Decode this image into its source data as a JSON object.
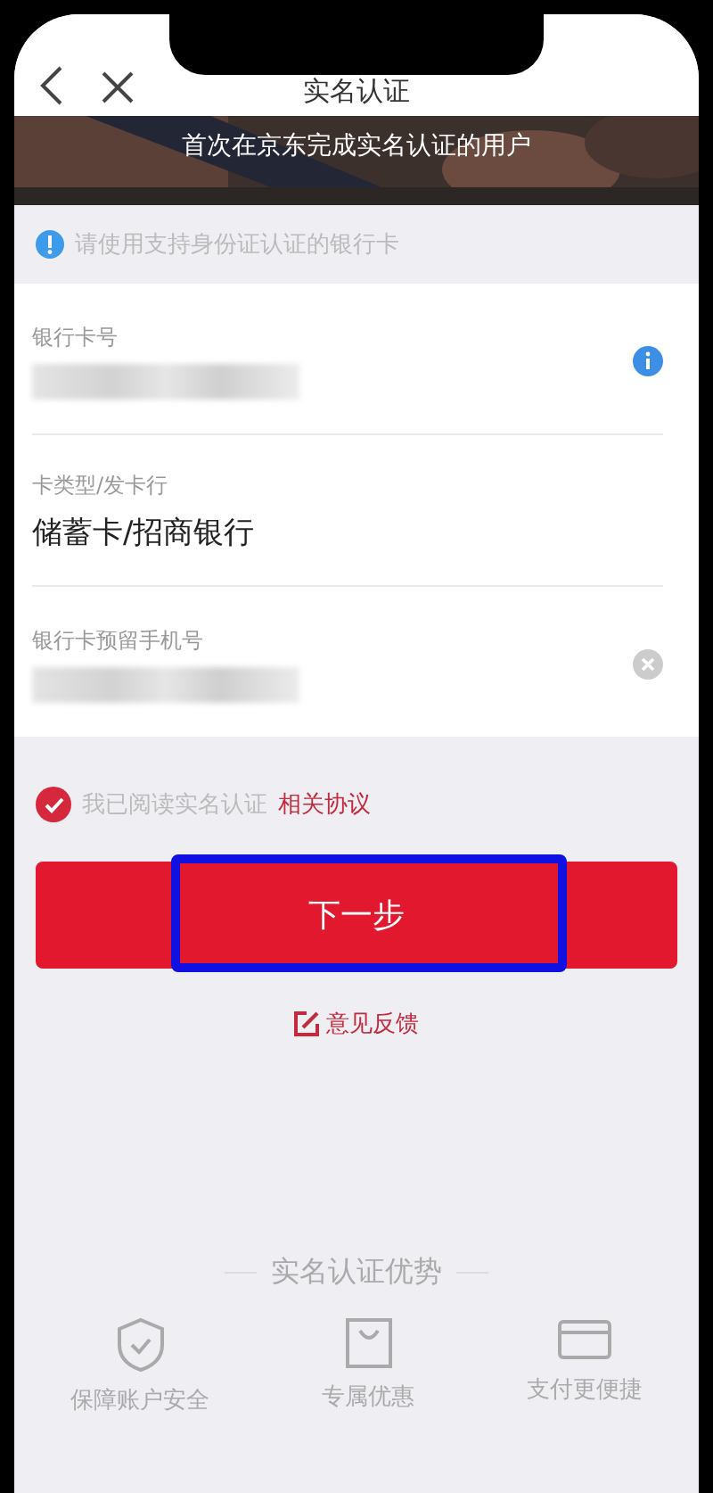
{
  "header": {
    "title": "实名认证"
  },
  "banner": {
    "text": "首次在京东完成实名认证的用户"
  },
  "notice": "请使用支持身份证认证的银行卡",
  "fields": [
    {
      "kind": "cardnumber",
      "label": "银行卡号"
    },
    {
      "kind": "text",
      "label": "卡类型/发卡行",
      "value": "储蓄卡/招商银行"
    },
    {
      "kind": "phone",
      "label": "银行卡预留手机号"
    }
  ],
  "agreement": {
    "checked": true,
    "text": "我已阅读实名认证",
    "link": "相关协议"
  },
  "next_button": {
    "label": "下一步",
    "highlighted": true
  },
  "feedback": "意见反馈",
  "advantages": {
    "title": "实名认证优势",
    "items": [
      {
        "kind": "shield",
        "label": "保障账户安全"
      },
      {
        "kind": "bag",
        "label": "专属优惠"
      },
      {
        "kind": "card",
        "label": "支付更便捷"
      }
    ]
  }
}
